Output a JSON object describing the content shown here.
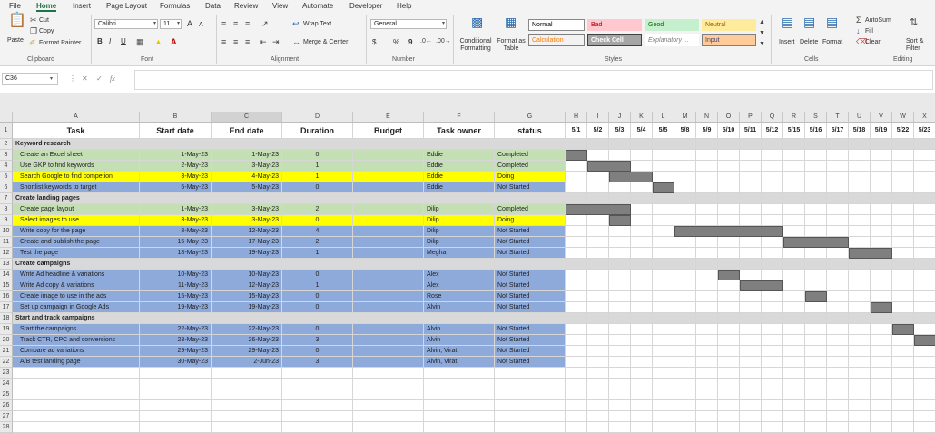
{
  "menu": {
    "tabs": [
      "File",
      "Home",
      "Insert",
      "Page Layout",
      "Formulas",
      "Data",
      "Review",
      "View",
      "Automate",
      "Developer",
      "Help"
    ],
    "active": "Home"
  },
  "ribbon": {
    "clipboard": {
      "paste": "Paste",
      "cut": "Cut",
      "copy": "Copy",
      "format_painter": "Format Painter",
      "label": "Clipboard"
    },
    "font": {
      "family": "Calibri",
      "size": "11",
      "grow": "A",
      "shrink": "A",
      "bold": "B",
      "italic": "I",
      "underline": "U",
      "label": "Font"
    },
    "alignment": {
      "wrap": "Wrap Text",
      "merge": "Merge & Center",
      "label": "Alignment"
    },
    "number": {
      "format": "General",
      "currency": "$",
      "percent": "%",
      "comma": "9",
      "label": "Number"
    },
    "styles": {
      "conditional": "Conditional Formatting",
      "format_table": "Format as Table",
      "boxes": [
        "Normal",
        "Bad",
        "Good",
        "Neutral",
        "Calculation",
        "Check Cell",
        "Explanatory ...",
        "Input"
      ],
      "label": "Styles"
    },
    "cells": {
      "insert": "Insert",
      "delete": "Delete",
      "format": "Format",
      "label": "Cells"
    },
    "editing": {
      "autosum": "AutoSum",
      "fill": "Fill",
      "clear": "Clear",
      "sort": "Sort & Filter",
      "label": "Editing"
    }
  },
  "formula_bar": {
    "name_box": "C36",
    "fx": "fx",
    "value": ""
  },
  "columns": [
    "A",
    "B",
    "C",
    "D",
    "E",
    "F",
    "G",
    "H",
    "I",
    "J",
    "K",
    "L",
    "M",
    "N",
    "O",
    "P",
    "Q",
    "R",
    "S",
    "T",
    "U",
    "V",
    "W",
    "X"
  ],
  "headers": [
    "Task",
    "Start date",
    "End date",
    "Duration",
    "Budget",
    "Task owner",
    "status"
  ],
  "date_headers": [
    "5/1",
    "5/2",
    "5/3",
    "5/4",
    "5/5",
    "5/8",
    "5/9",
    "5/10",
    "5/11",
    "5/12",
    "5/15",
    "5/16",
    "5/17",
    "5/18",
    "5/19",
    "5/22",
    "5/23"
  ],
  "rows": [
    {
      "num": "1",
      "type": "header"
    },
    {
      "num": "2",
      "type": "section",
      "task": "Keyword research"
    },
    {
      "num": "3",
      "type": "task",
      "color": "#c4dfb4",
      "task": "Create an Excel sheet",
      "start": "1-May-23",
      "end": "1-May-23",
      "duration": "0",
      "budget": "",
      "owner": "Eddie",
      "status": "Completed",
      "gantt": [
        0,
        1
      ]
    },
    {
      "num": "4",
      "type": "task",
      "color": "#c4dfb4",
      "task": "Use GKP to find keywords",
      "start": "2-May-23",
      "end": "3-May-23",
      "duration": "1",
      "budget": "",
      "owner": "Eddie",
      "status": "Completed",
      "gantt": [
        1,
        2
      ]
    },
    {
      "num": "5",
      "type": "task",
      "color": "#ffff00",
      "task": "Search Google to find competion",
      "start": "3-May-23",
      "end": "4-May-23",
      "duration": "1",
      "budget": "",
      "owner": "Eddie",
      "status": "Doing",
      "gantt": [
        2,
        2
      ]
    },
    {
      "num": "6",
      "type": "task",
      "color": "#8eaadb",
      "task": "Shortlist keywords to target",
      "start": "5-May-23",
      "end": "5-May-23",
      "duration": "0",
      "budget": "",
      "owner": "Eddie",
      "status": "Not Started",
      "gantt": [
        4,
        1
      ]
    },
    {
      "num": "7",
      "type": "section",
      "task": "Create landing pages"
    },
    {
      "num": "8",
      "type": "task",
      "color": "#c4dfb4",
      "task": "Create page layout",
      "start": "1-May-23",
      "end": "3-May-23",
      "duration": "2",
      "budget": "",
      "owner": "Dilip",
      "status": "Completed",
      "gantt": [
        0,
        3
      ]
    },
    {
      "num": "9",
      "type": "task",
      "color": "#ffff00",
      "task": "Select images to use",
      "start": "3-May-23",
      "end": "3-May-23",
      "duration": "0",
      "budget": "",
      "owner": "Dilip",
      "status": "Doing",
      "gantt": [
        2,
        1
      ]
    },
    {
      "num": "10",
      "type": "task",
      "color": "#8eaadb",
      "task": "Write copy for the page",
      "start": "8-May-23",
      "end": "12-May-23",
      "duration": "4",
      "budget": "",
      "owner": "Dilip",
      "status": "Not Started",
      "gantt": [
        5,
        5
      ]
    },
    {
      "num": "11",
      "type": "task",
      "color": "#8eaadb",
      "task": "Create and publish the page",
      "start": "15-May-23",
      "end": "17-May-23",
      "duration": "2",
      "budget": "",
      "owner": "Dilip",
      "status": "Not Started",
      "gantt": [
        10,
        3
      ]
    },
    {
      "num": "12",
      "type": "task",
      "color": "#8eaadb",
      "task": "Test the page",
      "start": "18-May-23",
      "end": "19-May-23",
      "duration": "1",
      "budget": "",
      "owner": "Megha",
      "status": "Not Started",
      "gantt": [
        13,
        2
      ]
    },
    {
      "num": "13",
      "type": "section",
      "task": "Create campaigns"
    },
    {
      "num": "14",
      "type": "task",
      "color": "#8eaadb",
      "task": "Write Ad headline & variations",
      "start": "10-May-23",
      "end": "10-May-23",
      "duration": "0",
      "budget": "",
      "owner": "Alex",
      "status": "Not Started",
      "gantt": [
        7,
        1
      ]
    },
    {
      "num": "15",
      "type": "task",
      "color": "#8eaadb",
      "task": "Write Ad copy & variations",
      "start": "11-May-23",
      "end": "12-May-23",
      "duration": "1",
      "budget": "",
      "owner": "Alex",
      "status": "Not Started",
      "gantt": [
        8,
        2
      ]
    },
    {
      "num": "16",
      "type": "task",
      "color": "#8eaadb",
      "task": "Create image to use in the ads",
      "start": "15-May-23",
      "end": "15-May-23",
      "duration": "0",
      "budget": "",
      "owner": "Rose",
      "status": "Not Started",
      "gantt": [
        11,
        1
      ]
    },
    {
      "num": "17",
      "type": "task",
      "color": "#8eaadb",
      "task": "Set up campaign in Google Ads",
      "start": "19-May-23",
      "end": "19-May-23",
      "duration": "0",
      "budget": "",
      "owner": "Alvin",
      "status": "Not Started",
      "gantt": [
        14,
        1
      ]
    },
    {
      "num": "18",
      "type": "section",
      "task": "Start and track campaigns"
    },
    {
      "num": "19",
      "type": "task",
      "color": "#8eaadb",
      "task": "Start the campaigns",
      "start": "22-May-23",
      "end": "22-May-23",
      "duration": "0",
      "budget": "",
      "owner": "Alvin",
      "status": "Not Started",
      "gantt": [
        15,
        1
      ]
    },
    {
      "num": "20",
      "type": "task",
      "color": "#8eaadb",
      "task": "Track CTR, CPC and conversions",
      "start": "23-May-23",
      "end": "26-May-23",
      "duration": "3",
      "budget": "",
      "owner": "Alvin",
      "status": "Not Started",
      "gantt": [
        16,
        1
      ]
    },
    {
      "num": "21",
      "type": "task",
      "color": "#8eaadb",
      "task": "Compare ad variations",
      "start": "29-May-23",
      "end": "29-May-23",
      "duration": "0",
      "budget": "",
      "owner": "Alvin, Virat",
      "status": "Not Started",
      "gantt": null
    },
    {
      "num": "22",
      "type": "task",
      "color": "#8eaadb",
      "task": "A/B test landing page",
      "start": "30-May-23",
      "end": "2-Jun-23",
      "duration": "3",
      "budget": "",
      "owner": "Alvin, Virat",
      "status": "Not Started",
      "gantt": null
    },
    {
      "num": "23",
      "type": "empty"
    },
    {
      "num": "24",
      "type": "empty"
    },
    {
      "num": "25",
      "type": "empty"
    },
    {
      "num": "26",
      "type": "empty"
    },
    {
      "num": "27",
      "type": "empty"
    },
    {
      "num": "28",
      "type": "empty"
    }
  ],
  "colors": {
    "section_fill": "#d9d9d9",
    "gantt_bar": "#7f7f7f",
    "accent": "#217346"
  }
}
